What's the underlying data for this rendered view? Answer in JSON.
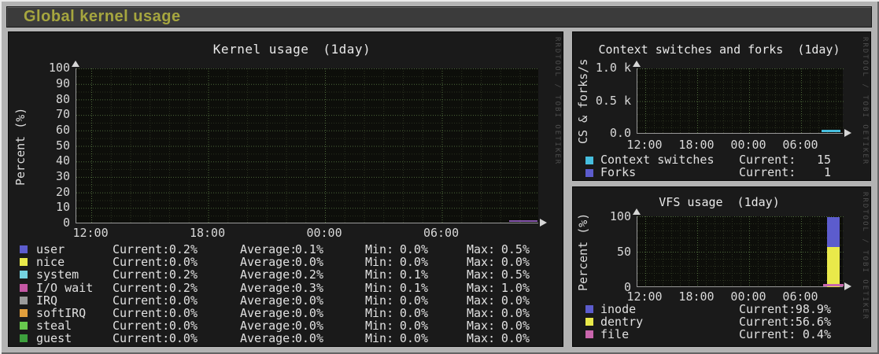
{
  "header": {
    "title": "Global kernel usage"
  },
  "watermark": "RRDTOOL / TOBI OETIKER",
  "charts": {
    "kernel": {
      "title": "Kernel usage",
      "period": "(1day)",
      "ylabel": "Percent (%)",
      "yticks": [
        "100",
        "90",
        "80",
        "70",
        "60",
        "50",
        "40",
        "30",
        "20",
        "10",
        "0"
      ],
      "xticks": [
        "12:00",
        "18:00",
        "00:00",
        "06:00"
      ],
      "labels": {
        "current": "Current:",
        "average": "Average:",
        "min": "Min:",
        "max": "Max:"
      },
      "trace_color": "#8757ae",
      "series": [
        {
          "name": "user",
          "color": "#5c5ccd",
          "current": "0.2%",
          "average": "0.1%",
          "min": "0.0%",
          "max": "0.5%"
        },
        {
          "name": "nice",
          "color": "#e9e94a",
          "current": "0.0%",
          "average": "0.0%",
          "min": "0.0%",
          "max": "0.0%"
        },
        {
          "name": "system",
          "color": "#74d2e0",
          "current": "0.2%",
          "average": "0.2%",
          "min": "0.1%",
          "max": "0.5%"
        },
        {
          "name": "I/O wait",
          "color": "#c558a5",
          "current": "0.2%",
          "average": "0.3%",
          "min": "0.1%",
          "max": "1.0%"
        },
        {
          "name": "IRQ",
          "color": "#9b9b9b",
          "current": "0.0%",
          "average": "0.0%",
          "min": "0.0%",
          "max": "0.0%"
        },
        {
          "name": "softIRQ",
          "color": "#e09e3c",
          "current": "0.0%",
          "average": "0.0%",
          "min": "0.0%",
          "max": "0.0%"
        },
        {
          "name": "steal",
          "color": "#68c94e",
          "current": "0.0%",
          "average": "0.0%",
          "min": "0.0%",
          "max": "0.0%"
        },
        {
          "name": "guest",
          "color": "#3da03d",
          "current": "0.0%",
          "average": "0.0%",
          "min": "0.0%",
          "max": "0.0%"
        }
      ]
    },
    "context": {
      "title": "Context switches and forks",
      "period": "(1day)",
      "ylabel": "CS & forks/s",
      "yticks": [
        "1.0 k",
        "0.5 k",
        "0.0"
      ],
      "xticks": [
        "12:00",
        "18:00",
        "00:00",
        "06:00"
      ],
      "labels": {
        "current": "Current:"
      },
      "series": [
        {
          "name": "Context switches",
          "color": "#46bede",
          "current": "15"
        },
        {
          "name": "Forks",
          "color": "#5c5ccd",
          "current": "1"
        }
      ]
    },
    "vfs": {
      "title": "VFS usage",
      "period": "(1day)",
      "ylabel": "Percent (%)",
      "yticks": [
        "100",
        "50",
        "0"
      ],
      "xticks": [
        "12:00",
        "18:00",
        "00:00",
        "06:00"
      ],
      "labels": {
        "current": "Current:"
      },
      "series": [
        {
          "name": "inode",
          "color": "#5c5ccd",
          "current": "98.9%",
          "value": 98.9
        },
        {
          "name": "dentry",
          "color": "#e9e94a",
          "current": "56.6%",
          "value": 56.6
        },
        {
          "name": "file",
          "color": "#c966ad",
          "current": "0.4%",
          "value": 0.4
        }
      ]
    }
  },
  "chart_data": [
    {
      "type": "line",
      "title": "Kernel usage (1day)",
      "xlabel": "",
      "ylabel": "Percent (%)",
      "ylim": [
        0,
        100
      ],
      "x_ticks": [
        "12:00",
        "18:00",
        "00:00",
        "06:00"
      ],
      "grid": true,
      "legend_position": "bottom",
      "series": [
        {
          "name": "user",
          "current": 0.2,
          "average": 0.1,
          "min": 0.0,
          "max": 0.5
        },
        {
          "name": "nice",
          "current": 0.0,
          "average": 0.0,
          "min": 0.0,
          "max": 0.0
        },
        {
          "name": "system",
          "current": 0.2,
          "average": 0.2,
          "min": 0.1,
          "max": 0.5
        },
        {
          "name": "I/O wait",
          "current": 0.2,
          "average": 0.3,
          "min": 0.1,
          "max": 1.0
        },
        {
          "name": "IRQ",
          "current": 0.0,
          "average": 0.0,
          "min": 0.0,
          "max": 0.0
        },
        {
          "name": "softIRQ",
          "current": 0.0,
          "average": 0.0,
          "min": 0.0,
          "max": 0.0
        },
        {
          "name": "steal",
          "current": 0.0,
          "average": 0.0,
          "min": 0.0,
          "max": 0.0
        },
        {
          "name": "guest",
          "current": 0.0,
          "average": 0.0,
          "min": 0.0,
          "max": 0.0
        }
      ]
    },
    {
      "type": "line",
      "title": "Context switches and forks (1day)",
      "xlabel": "",
      "ylabel": "CS & forks/s",
      "ylim": [
        0,
        1000
      ],
      "y_ticks": [
        "1.0 k",
        "0.5 k",
        "0.0"
      ],
      "x_ticks": [
        "12:00",
        "18:00",
        "00:00",
        "06:00"
      ],
      "grid": true,
      "legend_position": "bottom",
      "series": [
        {
          "name": "Context switches",
          "current": 15
        },
        {
          "name": "Forks",
          "current": 1
        }
      ]
    },
    {
      "type": "area",
      "title": "VFS usage (1day)",
      "xlabel": "",
      "ylabel": "Percent (%)",
      "ylim": [
        0,
        100
      ],
      "x_ticks": [
        "12:00",
        "18:00",
        "00:00",
        "06:00"
      ],
      "grid": true,
      "legend_position": "bottom",
      "series": [
        {
          "name": "inode",
          "current": 98.9
        },
        {
          "name": "dentry",
          "current": 56.6
        },
        {
          "name": "file",
          "current": 0.4
        }
      ]
    }
  ]
}
